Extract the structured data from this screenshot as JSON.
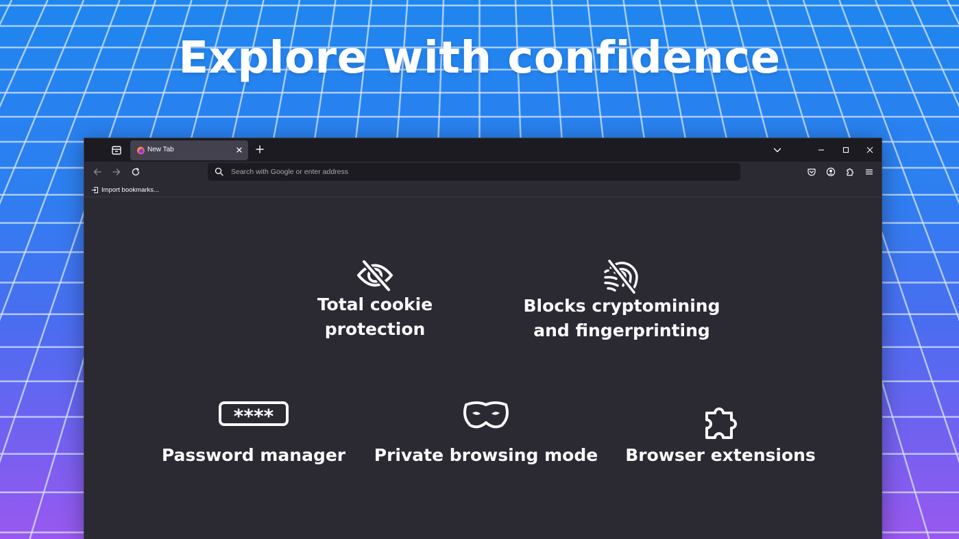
{
  "headline": "Explore with confidence",
  "colors": {
    "background_top": "#1f86ee",
    "background_bottom": "#9a58ee",
    "grid_lines": "#cfe0ff",
    "window_bg": "#2b2a33",
    "tabbar_bg": "#1c1b22",
    "active_tab_bg": "#42414d",
    "text": "#fbfbfe"
  },
  "browser": {
    "tabs": [
      {
        "title": "New Tab",
        "icon": "firefox-logo-icon",
        "active": true
      }
    ],
    "toolbar": {
      "back_icon": "arrow-left-icon",
      "forward_icon": "arrow-right-icon",
      "reload_icon": "reload-icon",
      "urlbar_placeholder": "Search with Google or enter address",
      "right_icons": [
        "pocket-icon",
        "account-icon",
        "extensions-icon",
        "menu-icon"
      ]
    },
    "bookmarks_bar": {
      "import_label": "Import bookmarks..."
    }
  },
  "features": {
    "cookie": {
      "line1": "Total cookie",
      "line2": "protection",
      "icon": "eye-slash-icon"
    },
    "crypto": {
      "line1": "Blocks cryptomining",
      "line2": "and fingerprinting",
      "icon": "fingerprint-slash-icon"
    },
    "password": {
      "label": "Password manager",
      "icon": "password-icon"
    },
    "private": {
      "label": "Private browsing mode",
      "icon": "mask-icon"
    },
    "extensions": {
      "label": "Browser extensions",
      "icon": "puzzle-icon"
    }
  }
}
